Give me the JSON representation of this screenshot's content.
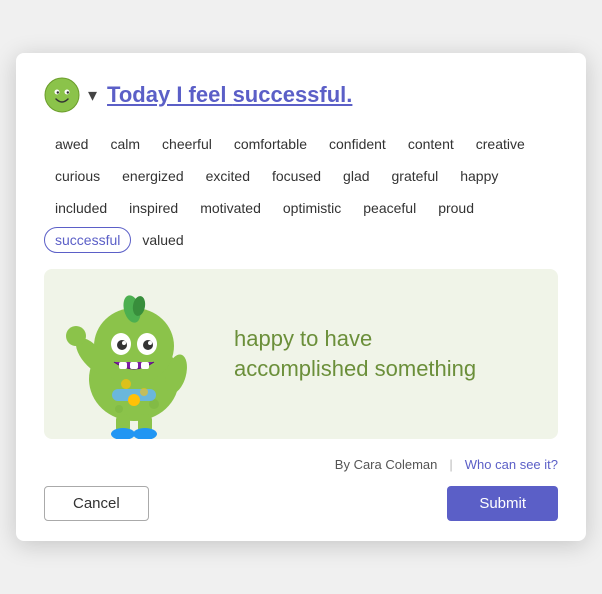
{
  "header": {
    "title_prefix": "Today I feel ",
    "title_feeling": "successful.",
    "chevron": "▾"
  },
  "feelings": [
    {
      "label": "awed",
      "selected": false
    },
    {
      "label": "calm",
      "selected": false
    },
    {
      "label": "cheerful",
      "selected": false
    },
    {
      "label": "comfortable",
      "selected": false
    },
    {
      "label": "confident",
      "selected": false
    },
    {
      "label": "content",
      "selected": false
    },
    {
      "label": "creative",
      "selected": false
    },
    {
      "label": "curious",
      "selected": false
    },
    {
      "label": "energized",
      "selected": false
    },
    {
      "label": "excited",
      "selected": false
    },
    {
      "label": "focused",
      "selected": false
    },
    {
      "label": "glad",
      "selected": false
    },
    {
      "label": "grateful",
      "selected": false
    },
    {
      "label": "happy",
      "selected": false
    },
    {
      "label": "included",
      "selected": false
    },
    {
      "label": "inspired",
      "selected": false
    },
    {
      "label": "motivated",
      "selected": false
    },
    {
      "label": "optimistic",
      "selected": false
    },
    {
      "label": "peaceful",
      "selected": false
    },
    {
      "label": "proud",
      "selected": false
    },
    {
      "label": "successful",
      "selected": true
    },
    {
      "label": "valued",
      "selected": false
    }
  ],
  "character": {
    "description_line1": "happy to have",
    "description_line2": "accomplished something"
  },
  "footer": {
    "by_label": "By Cara Coleman",
    "separator": "|",
    "who_can_see": "Who can see it?"
  },
  "actions": {
    "cancel": "Cancel",
    "submit": "Submit"
  }
}
